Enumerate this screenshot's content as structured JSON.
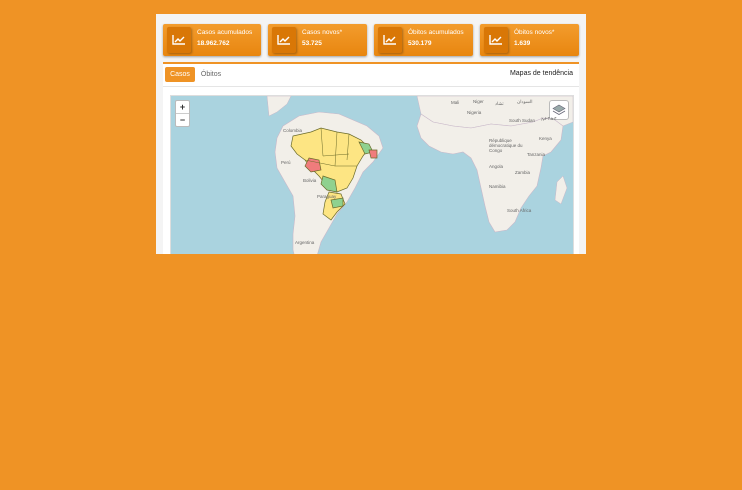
{
  "cards": [
    {
      "label": "Casos acumulados",
      "value": "18.962.762",
      "icon": "trend-chart-icon"
    },
    {
      "label": "Casos novos*",
      "value": "53.725",
      "icon": "trend-chart-icon"
    },
    {
      "label": "Óbitos acumulados",
      "value": "530.179",
      "icon": "trend-chart-icon"
    },
    {
      "label": "Óbitos novos*",
      "value": "1.639",
      "icon": "trend-chart-icon"
    }
  ],
  "tabs": [
    {
      "label": "Casos",
      "active": true
    },
    {
      "label": "Óbitos",
      "active": false
    }
  ],
  "trend_title": "Mapas de tendência",
  "map": {
    "zoom_in": "+",
    "zoom_out": "−",
    "labels": {
      "mali": "Mali",
      "niger": "Niger",
      "chad": "تشاد",
      "sudan": "السودان",
      "nigeria": "Nigeria",
      "south_sudan": "South Sudan",
      "ethiopia": "ኢትዮጵያ",
      "kenya": "Kenya",
      "drc": "République démocratique du Congo",
      "tanzania": "Tanzania",
      "angola": "Angola",
      "zambia": "Zambia",
      "namibia": "Namibia",
      "south_africa": "South Africa",
      "colombia": "Colombia",
      "peru": "Perú",
      "bolivia": "Bolivia",
      "paraguay": "Paraguay",
      "argentina": "Argentina"
    },
    "colors": {
      "water": "#aad3df",
      "land": "#f2efe9",
      "yellow": "#fde583",
      "green": "#8fd18f",
      "red": "#f07c7c"
    }
  }
}
